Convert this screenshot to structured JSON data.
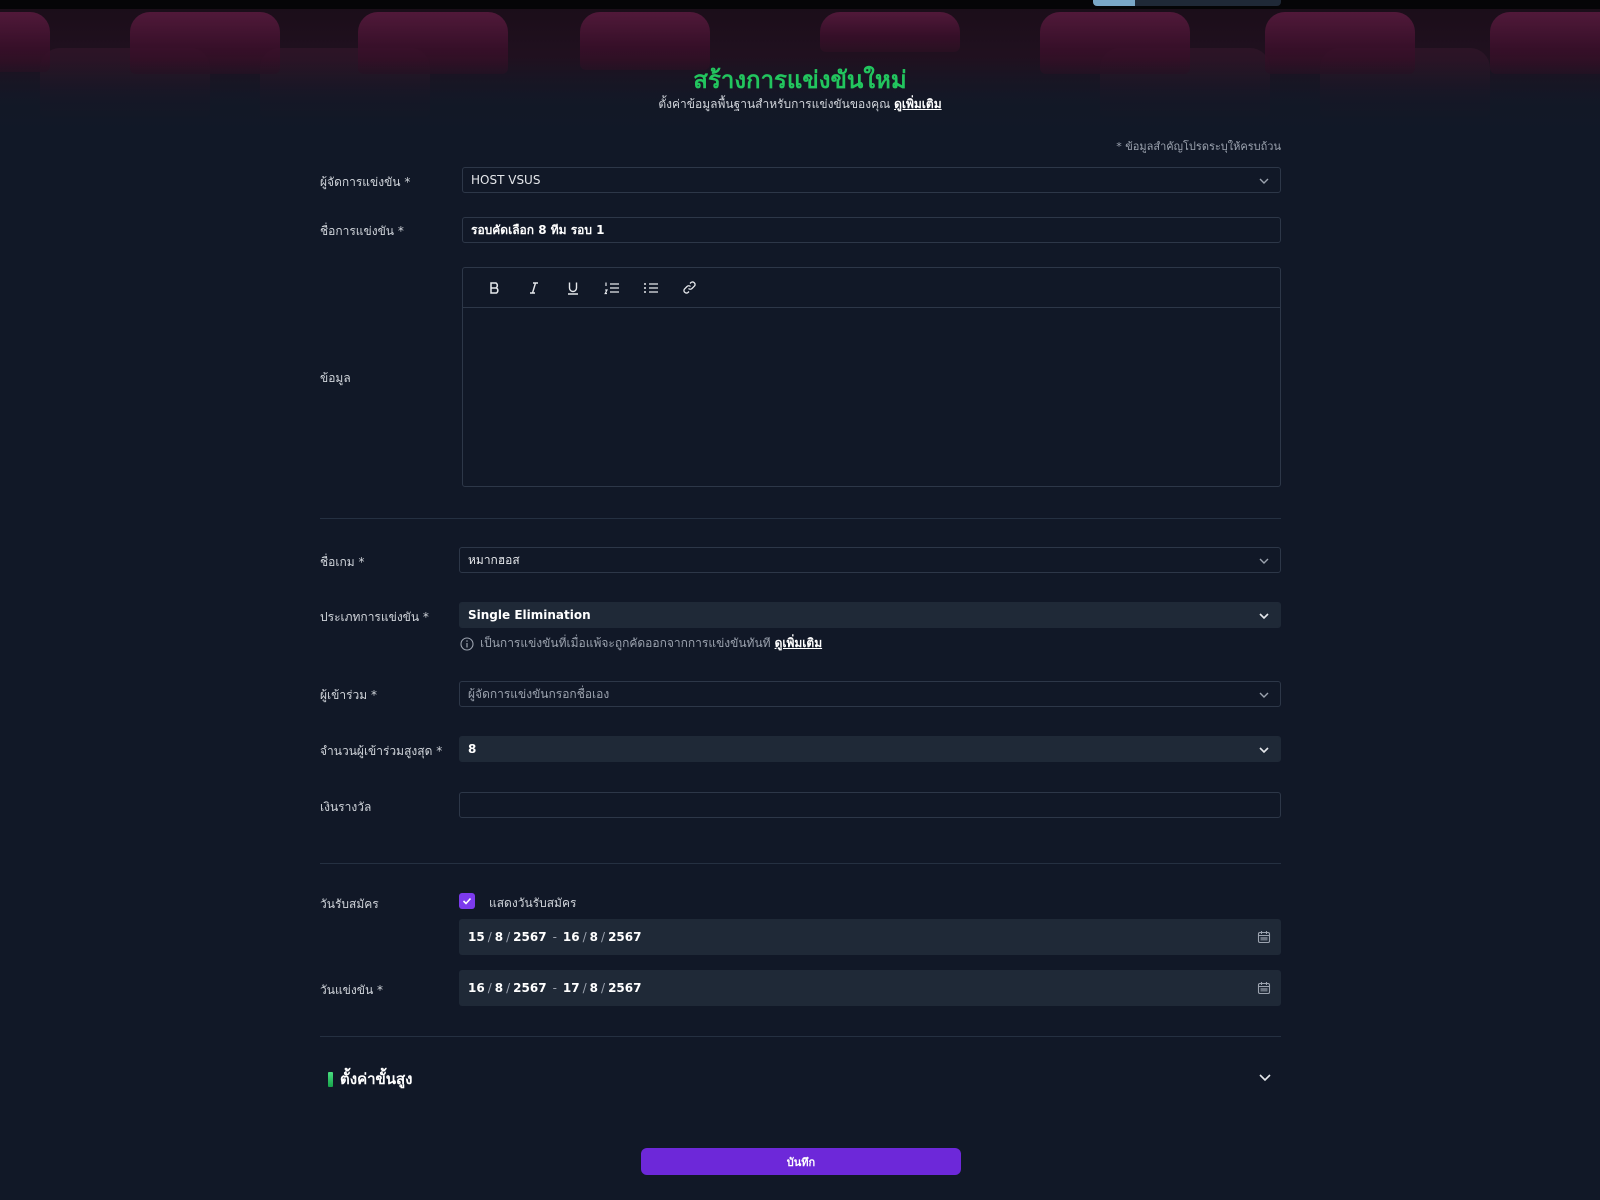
{
  "header": {
    "title": "สร้างการแข่งขันใหม่",
    "subtitle": "ตั้งค่าข้อมูลพื้นฐานสำหรับการแข่งขันของคุณ",
    "learn_more": "ดูเพิ่มเติม"
  },
  "form": {
    "required_note": "* ข้อมูลสำคัญโปรดระบุให้ครบถ้วน",
    "organizer": {
      "label": "ผู้จัดการแข่งขัน *",
      "value": "HOST VSUS"
    },
    "tournament_name": {
      "label": "ชื่อการแข่งขัน *",
      "value": "รอบคัดเลือก 8 ทีม รอบ 1"
    },
    "info": {
      "label": "ข้อมูล"
    },
    "game_name": {
      "label": "ชื่อเกม *",
      "value": "หมากฮอส"
    },
    "tournament_type": {
      "label": "ประเภทการแข่งขัน *",
      "value": "Single Elimination",
      "hint": "เป็นการแข่งขันที่เมื่อแพ้จะถูกคัดออกจากการแข่งขันทันที",
      "hint_link": "ดูเพิ่มเติม"
    },
    "participants": {
      "label": "ผู้เข้าร่วม *",
      "placeholder": "ผู้จัดการแข่งขันกรอกชื่อเอง"
    },
    "max_participants": {
      "label": "จำนวนผู้เข้าร่วมสูงสุด *",
      "value": "8"
    },
    "prize": {
      "label": "เงินรางวัล",
      "value": ""
    },
    "registration": {
      "label": "วันรับสมัคร",
      "show_label": "แสดงวันรับสมัคร",
      "checked": true,
      "start": {
        "d": "15",
        "m": "8",
        "y": "2567"
      },
      "end": {
        "d": "16",
        "m": "8",
        "y": "2567"
      }
    },
    "competition_date": {
      "label": "วันแข่งขัน *",
      "start": {
        "d": "16",
        "m": "8",
        "y": "2567"
      },
      "end": {
        "d": "17",
        "m": "8",
        "y": "2567"
      }
    },
    "advanced": {
      "label": "ตั้งค่าขั้นสูง"
    },
    "save_label": "บันทึก"
  },
  "toolbar": {
    "tools": [
      "bold-icon",
      "italic-icon",
      "underline-icon",
      "ordered-list-icon",
      "bullet-list-icon",
      "link-icon"
    ]
  },
  "colors": {
    "title_green": "#22c55e",
    "accent_purple": "#6d28d9",
    "background": "#111827"
  }
}
